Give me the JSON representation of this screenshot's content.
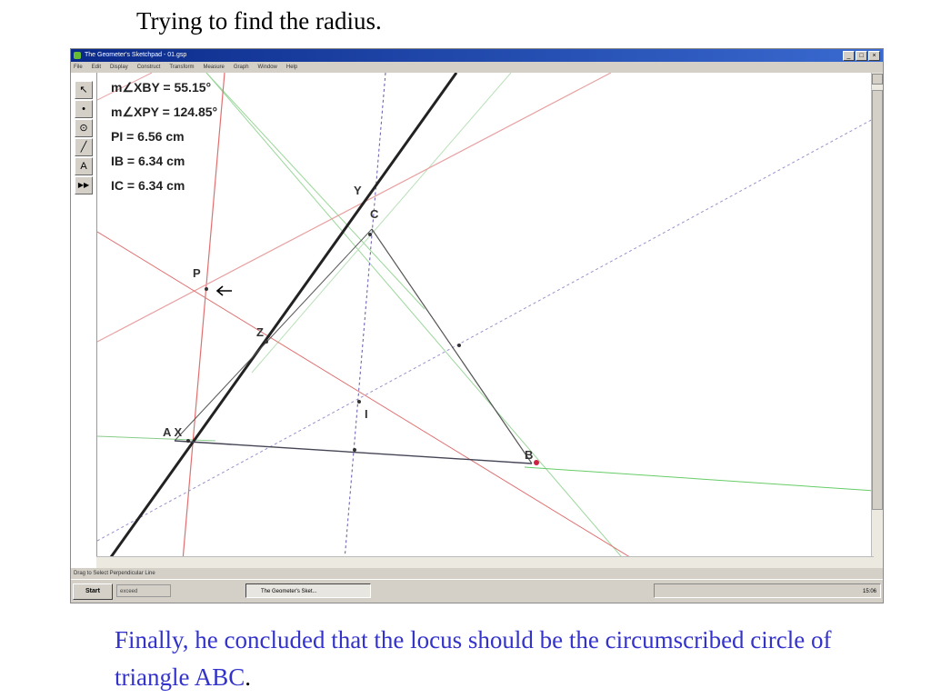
{
  "slide": {
    "title": "Trying to find the radius.",
    "caption": "Finally, he concluded that the locus should be the circumscribed circle of triangle ABC",
    "caption_end": "."
  },
  "window": {
    "title": "The Geometer's Sketchpad - 01.gsp",
    "buttons": [
      "_",
      "□",
      "×"
    ],
    "menu": [
      "File",
      "Edit",
      "Display",
      "Construct",
      "Transform",
      "Measure",
      "Graph",
      "Window",
      "Help"
    ],
    "status": "Drag to Select Perpendicular Line"
  },
  "toolbox": [
    {
      "icon": "arrow-select-icon",
      "glyph": "↖"
    },
    {
      "icon": "point-tool-icon",
      "glyph": "•"
    },
    {
      "icon": "compass-tool-icon",
      "glyph": "⊙"
    },
    {
      "icon": "straightedge-tool-icon",
      "glyph": "╱"
    },
    {
      "icon": "text-tool-icon",
      "glyph": "A"
    },
    {
      "icon": "custom-tool-icon",
      "glyph": "▶▶"
    }
  ],
  "measurements": [
    "m∠XBY = 55.15°",
    "m∠XPY = 124.85°",
    "PI = 6.56 cm",
    "IB = 6.34 cm",
    "IC = 6.34 cm"
  ],
  "labels": {
    "Y": "Y",
    "C": "C",
    "P": "P",
    "Z": "Z",
    "I": "I",
    "AX": "A X",
    "B": "B"
  },
  "taskbar": {
    "start": "Start",
    "quick": "exceed",
    "task": "The Geometer's Sket...",
    "clock": "15:06"
  },
  "colors": {
    "caption": "#3333cc",
    "thick_line": "#222222",
    "red_line": "#e07070",
    "green_line": "#66cc66",
    "purple_dashed": "#6655aa",
    "triangle": "#555555"
  }
}
